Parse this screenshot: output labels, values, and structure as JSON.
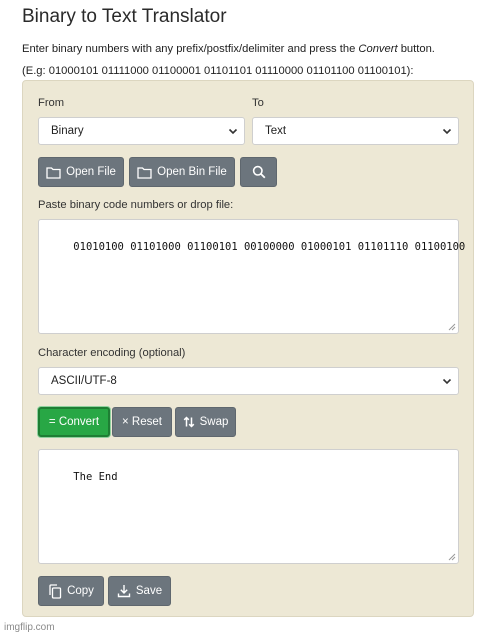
{
  "page": {
    "title": "Binary to Text Translator",
    "intro_before": "Enter binary numbers with any prefix/postfix/delimiter and press the ",
    "intro_em": "Convert",
    "intro_after": " button.",
    "example": "(E.g: 01000101 01111000 01100001 01101101 01110000 01101100 01100101):"
  },
  "form": {
    "from_label": "From",
    "from_value": "Binary",
    "to_label": "To",
    "to_value": "Text",
    "open_file": "Open File",
    "open_bin_file": "Open Bin File",
    "input_label": "Paste binary code numbers or drop file:",
    "input_value": "01010100 01101000 01100101 00100000 01000101 01101110 01100100",
    "encoding_label": "Character encoding (optional)",
    "encoding_value": "ASCII/UTF-8",
    "convert": "= Convert",
    "reset": "× Reset",
    "swap": "Swap",
    "output_value": "The End",
    "copy": "Copy",
    "save": "Save"
  },
  "icons": {
    "open_file": "folder-icon",
    "open_bin_file": "folder-icon",
    "search": "search-icon",
    "swap": "swap-arrows-icon",
    "copy": "copy-icon",
    "save": "download-icon",
    "select": "chevron-down-icon"
  },
  "colors": {
    "panel": "#ede8d5",
    "button": "#6c757d",
    "convert": "#28a745"
  },
  "watermark": "imgflip.com"
}
